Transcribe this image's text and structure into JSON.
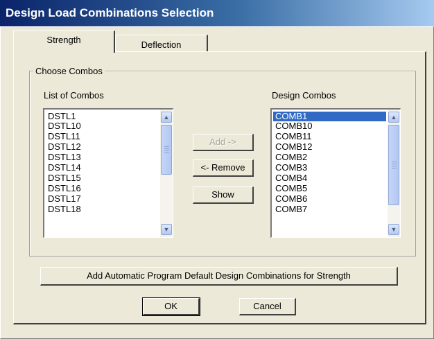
{
  "window": {
    "title": "Design Load Combinations Selection"
  },
  "tabs": [
    {
      "label": "Strength",
      "active": true
    },
    {
      "label": "Deflection",
      "active": false
    }
  ],
  "group": {
    "title": "Choose Combos"
  },
  "list_of_combos": {
    "label": "List of Combos",
    "items": [
      "DSTL1",
      "DSTL10",
      "DSTL11",
      "DSTL12",
      "DSTL13",
      "DSTL14",
      "DSTL15",
      "DSTL16",
      "DSTL17",
      "DSTL18"
    ]
  },
  "design_combos": {
    "label": "Design Combos",
    "items": [
      "COMB1",
      "COMB10",
      "COMB11",
      "COMB12",
      "COMB2",
      "COMB3",
      "COMB4",
      "COMB5",
      "COMB6",
      "COMB7"
    ],
    "selected_index": 0
  },
  "buttons": {
    "add": "Add ->",
    "remove": "<- Remove",
    "show": "Show",
    "auto_default": "Add Automatic Program Default Design Combinations for Strength",
    "ok": "OK",
    "cancel": "Cancel"
  },
  "icons": {
    "scroll_up": "chevron-up-icon",
    "scroll_down": "chevron-down-icon"
  },
  "colors": {
    "title_bar": "#0a246a",
    "selection": "#316ac5",
    "dialog_bg": "#ece9d8"
  }
}
